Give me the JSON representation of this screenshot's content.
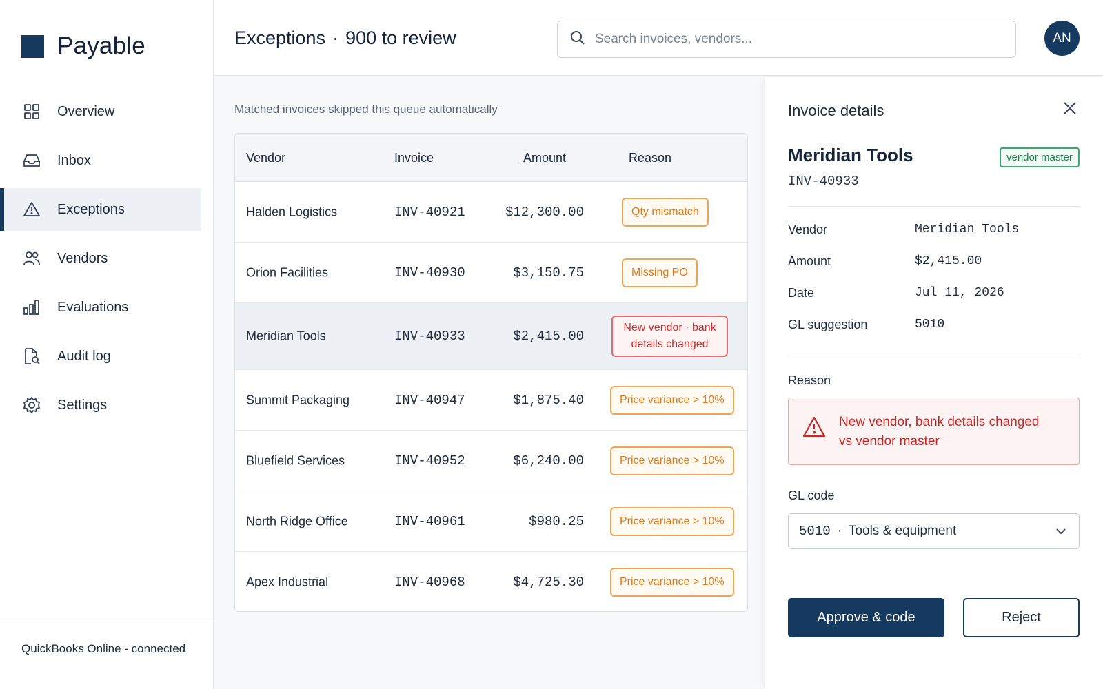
{
  "app": {
    "name": "Payable"
  },
  "sidebar": {
    "items": [
      {
        "label": "Overview",
        "icon": "grid-icon",
        "active": false
      },
      {
        "label": "Inbox",
        "icon": "inbox-icon",
        "active": false
      },
      {
        "label": "Exceptions",
        "icon": "warning-triangle-icon",
        "active": true
      },
      {
        "label": "Vendors",
        "icon": "users-icon",
        "active": false
      },
      {
        "label": "Evaluations",
        "icon": "bar-chart-icon",
        "active": false
      },
      {
        "label": "Audit log",
        "icon": "file-search-icon",
        "active": false
      },
      {
        "label": "Settings",
        "icon": "gear-icon",
        "active": false
      }
    ],
    "footer": "QuickBooks Online - connected"
  },
  "header": {
    "title": "Exceptions",
    "separator": "·",
    "count": "900 to review",
    "search_placeholder": "Search invoices, vendors...",
    "avatar_initials": "AN"
  },
  "main": {
    "subtitle": "Matched invoices skipped this queue automatically",
    "columns": [
      "Vendor",
      "Invoice",
      "Amount",
      "Reason"
    ],
    "rows": [
      {
        "vendor": "Halden Logistics",
        "invoice": "INV-40921",
        "amount": "$12,300.00",
        "reason": "Qty mismatch",
        "severity": "warn"
      },
      {
        "vendor": "Orion Facilities",
        "invoice": "INV-40930",
        "amount": "$3,150.75",
        "reason": "Missing PO",
        "severity": "warn"
      },
      {
        "vendor": "Meridian Tools",
        "invoice": "INV-40933",
        "amount": "$2,415.00",
        "reason_line1": "New vendor · bank",
        "reason_line2": "details changed",
        "severity": "danger",
        "selected": true
      },
      {
        "vendor": "Summit Packaging",
        "invoice": "INV-40947",
        "amount": "$1,875.40",
        "reason": "Price variance > 10%",
        "severity": "warn"
      },
      {
        "vendor": "Bluefield Services",
        "invoice": "INV-40952",
        "amount": "$6,240.00",
        "reason": "Price variance > 10%",
        "severity": "warn"
      },
      {
        "vendor": "North Ridge Office",
        "invoice": "INV-40961",
        "amount": "$980.25",
        "reason": "Price variance > 10%",
        "severity": "warn"
      },
      {
        "vendor": "Apex Industrial",
        "invoice": "INV-40968",
        "amount": "$4,725.30",
        "reason": "Price variance > 10%",
        "severity": "warn"
      }
    ]
  },
  "panel": {
    "title": "Invoice details",
    "vendor_name": "Meridian Tools",
    "vendor_badge": "vendor master",
    "invoice_number": "INV-40933",
    "fields": [
      {
        "label": "Vendor",
        "value": "Meridian Tools"
      },
      {
        "label": "Amount",
        "value": "$2,415.00"
      },
      {
        "label": "Date",
        "value": "Jul 11, 2026"
      },
      {
        "label": "GL suggestion",
        "value": "5010"
      }
    ],
    "reason_label": "Reason",
    "reason_line1": "New vendor, bank details changed",
    "reason_line2": "vs vendor master",
    "gl_label": "GL code",
    "gl_code": "5010",
    "gl_separator": "·",
    "gl_name": "Tools & equipment",
    "approve_label": "Approve & code",
    "reject_label": "Reject"
  },
  "colors": {
    "brand": "#163a5f",
    "warn": "#e07a1a",
    "danger": "#d42a2a",
    "success": "#23804f"
  }
}
